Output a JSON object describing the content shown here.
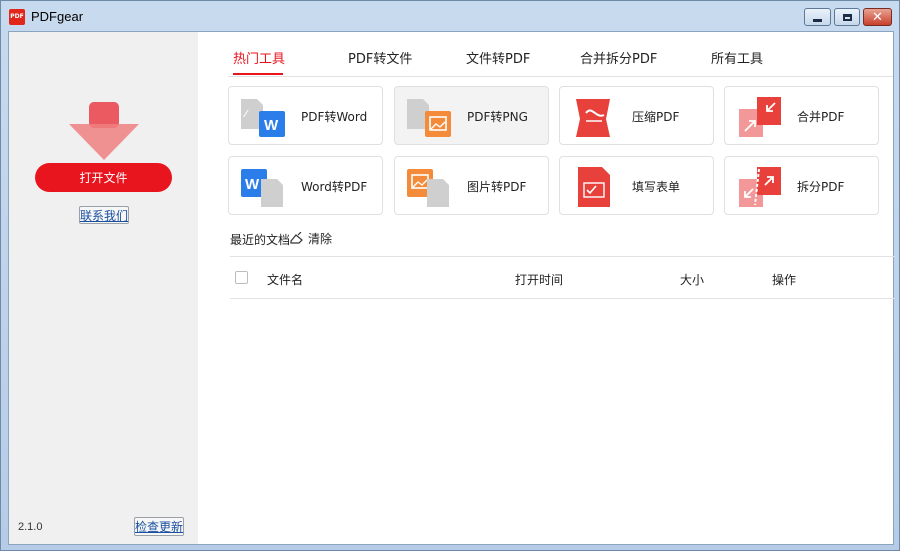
{
  "window": {
    "title": "PDFgear",
    "app_icon_text": "PDF",
    "min_glyph": "",
    "max_glyph": "",
    "close_glyph": "✕"
  },
  "sidebar": {
    "open_button": "打开文件",
    "contact_link": "联系我们",
    "version": "2.1.0",
    "update_link": "检查更新"
  },
  "tabs": [
    "热门工具",
    "PDF转文件",
    "文件转PDF",
    "合并拆分PDF",
    "所有工具"
  ],
  "active_tab": "热门工具",
  "tools": [
    {
      "label": "PDF转Word",
      "icon": "pdf-to-word-icon"
    },
    {
      "label": "PDF转PNG",
      "icon": "pdf-to-png-icon"
    },
    {
      "label": "压缩PDF",
      "icon": "compress-pdf-icon"
    },
    {
      "label": "合并PDF",
      "icon": "merge-pdf-icon"
    },
    {
      "label": "Word转PDF",
      "icon": "word-to-pdf-icon"
    },
    {
      "label": "图片转PDF",
      "icon": "image-to-pdf-icon"
    },
    {
      "label": "填写表单",
      "icon": "fill-form-icon"
    },
    {
      "label": "拆分PDF",
      "icon": "split-pdf-icon"
    }
  ],
  "recent": {
    "title": "最近的文档",
    "clear": "清除",
    "columns": [
      "文件名",
      "打开时间",
      "大小",
      "操作"
    ]
  },
  "colors": {
    "accent": "#e8141e",
    "word_blue": "#2b7de9",
    "png_orange": "#f38b3a",
    "pdf_red": "#e8403a",
    "doc_gray": "#c9c9c9"
  }
}
